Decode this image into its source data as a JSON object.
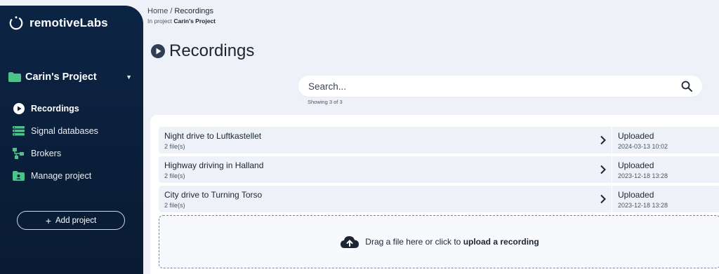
{
  "app": {
    "logo_text": "remotiveLabs"
  },
  "sidebar": {
    "project_name": "Carin's Project",
    "items": [
      {
        "label": "Recordings",
        "icon": "play-circle-icon",
        "active": true
      },
      {
        "label": "Signal databases",
        "icon": "database-icon",
        "active": false
      },
      {
        "label": "Brokers",
        "icon": "broker-network-icon",
        "active": false
      },
      {
        "label": "Manage project",
        "icon": "manage-project-icon",
        "active": false
      }
    ],
    "add_project_label": "Add project"
  },
  "breadcrumb": {
    "home": "Home",
    "separator": "/",
    "current": "Recordings",
    "subtitle_prefix": "In project",
    "subtitle_project": "Carin's Project"
  },
  "page": {
    "title": "Recordings"
  },
  "search": {
    "placeholder": "Search...",
    "value": "",
    "showing": "Showing 3 of 3"
  },
  "recordings": [
    {
      "name": "Night drive to Luftkastellet",
      "files": "2 file(s)",
      "status": "Uploaded",
      "date": "2024-03-13 10:02"
    },
    {
      "name": "Highway driving in Halland",
      "files": "2 file(s)",
      "status": "Uploaded",
      "date": "2023-12-18 13:28"
    },
    {
      "name": "City drive to Turning Torso",
      "files": "2 file(s)",
      "status": "Uploaded",
      "date": "2023-12-18 13:28"
    }
  ],
  "upload": {
    "text_prefix": "Drag a file here or click to",
    "text_bold": "upload a recording"
  },
  "colors": {
    "sidebar_bg": "#0c2444",
    "accent_green": "#4cc38a",
    "page_bg": "#eef2f8",
    "row_bg": "#eef2f8"
  }
}
